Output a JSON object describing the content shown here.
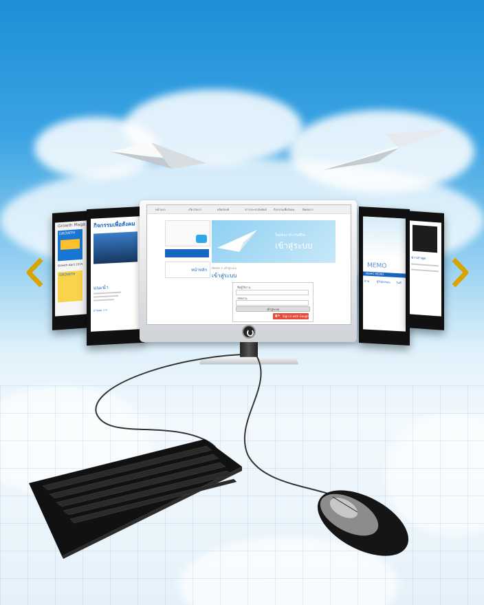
{
  "colors": {
    "sky_top": "#1e8fd8",
    "sky_mid": "#8fcdf0",
    "accent_blue": "#1565c0",
    "google_red": "#e64a3b",
    "arrow_gold": "#d9a400"
  },
  "left_panels": {
    "magazine": {
      "title": "Growth Maga",
      "cover_word": "GROWTH",
      "caption": "Growth April 2015"
    },
    "activity": {
      "title": "กิจกรรมเพื่อสังคม",
      "section": "แนะนำ",
      "link": "อ่านต่อ >>"
    }
  },
  "monitor": {
    "nav_items": [
      "หน้าแรก",
      "เกี่ยวกับเรา",
      "ผลิตภัณฑ์",
      "ข่าวประชาสัมพันธ์",
      "กิจกรรมเพื่อสังคม",
      "ติดต่อเรา"
    ],
    "sidebar_label": "หน้าหลัก",
    "banner_small": "ใหม่ของ ประกันชีวิต",
    "banner_title": "เข้าสู่ระบบ",
    "breadcrumb": "Home > เข้าสู่ระบบ",
    "page_title": "เข้าสู่ระบบ",
    "form_label_user": "ชื่อผู้ใช้งาน",
    "form_label_pass": "รหัสผ่าน",
    "login_button": "เข้าสู่ระบบ",
    "google_button": "Sign in with Google"
  },
  "right_panels": {
    "memo": {
      "title": "MEMO",
      "row": "MEMO MEMO",
      "columns": [
        "ฝ่าย",
        "ผู้รับผิดชอบ",
        "วันที่"
      ]
    },
    "post": {
      "title": "ข่าวล่าสุด"
    }
  },
  "icons": {
    "prev": "chevron-left-icon",
    "next": "chevron-right-icon",
    "power": "power-icon"
  }
}
